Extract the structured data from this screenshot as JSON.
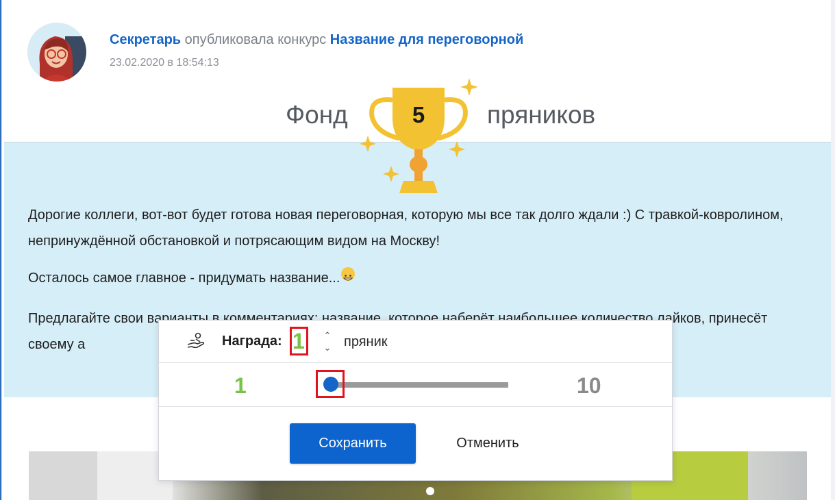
{
  "post": {
    "author": "Секретарь",
    "action": " опубликовала конкурс ",
    "contest_title": "Название для переговорной",
    "date": "23.02.2020 в 18:54:13"
  },
  "fund": {
    "label_left": "Фонд",
    "amount": "5",
    "label_right": "пряников"
  },
  "body": {
    "paragraph1": "Дорогие коллеги, вот-вот будет готова новая переговорная, которую мы все так долго ждали :) С травкой-ковролином, непринуждённой обстановкой и потрясающим видом на Москву!",
    "paragraph2": "Осталось самое главное - придумать название...",
    "paragraph3": "Предлагайте свои варианты в комментариях: название, которое наберёт наибольшее количество лайков, принесёт своему а"
  },
  "reward_popup": {
    "label": "Награда:",
    "value": "1",
    "unit": "пряник",
    "stepper_up": "⌃",
    "stepper_down": "⌄",
    "range_min": "1",
    "range_max": "10",
    "slider_value": 1,
    "save_label": "Сохранить",
    "cancel_label": "Отменить"
  },
  "colors": {
    "link": "#1565c8",
    "primary_button": "#0d64cf",
    "highlight_box": "#e0141e",
    "value_green": "#79c24a",
    "band": "#d6eef8",
    "trophy": "#f2c232"
  },
  "icons": [
    "avatar-secretary",
    "trophy-icon",
    "sparkle-icon",
    "hand-gift-icon",
    "grinning-emoji"
  ]
}
